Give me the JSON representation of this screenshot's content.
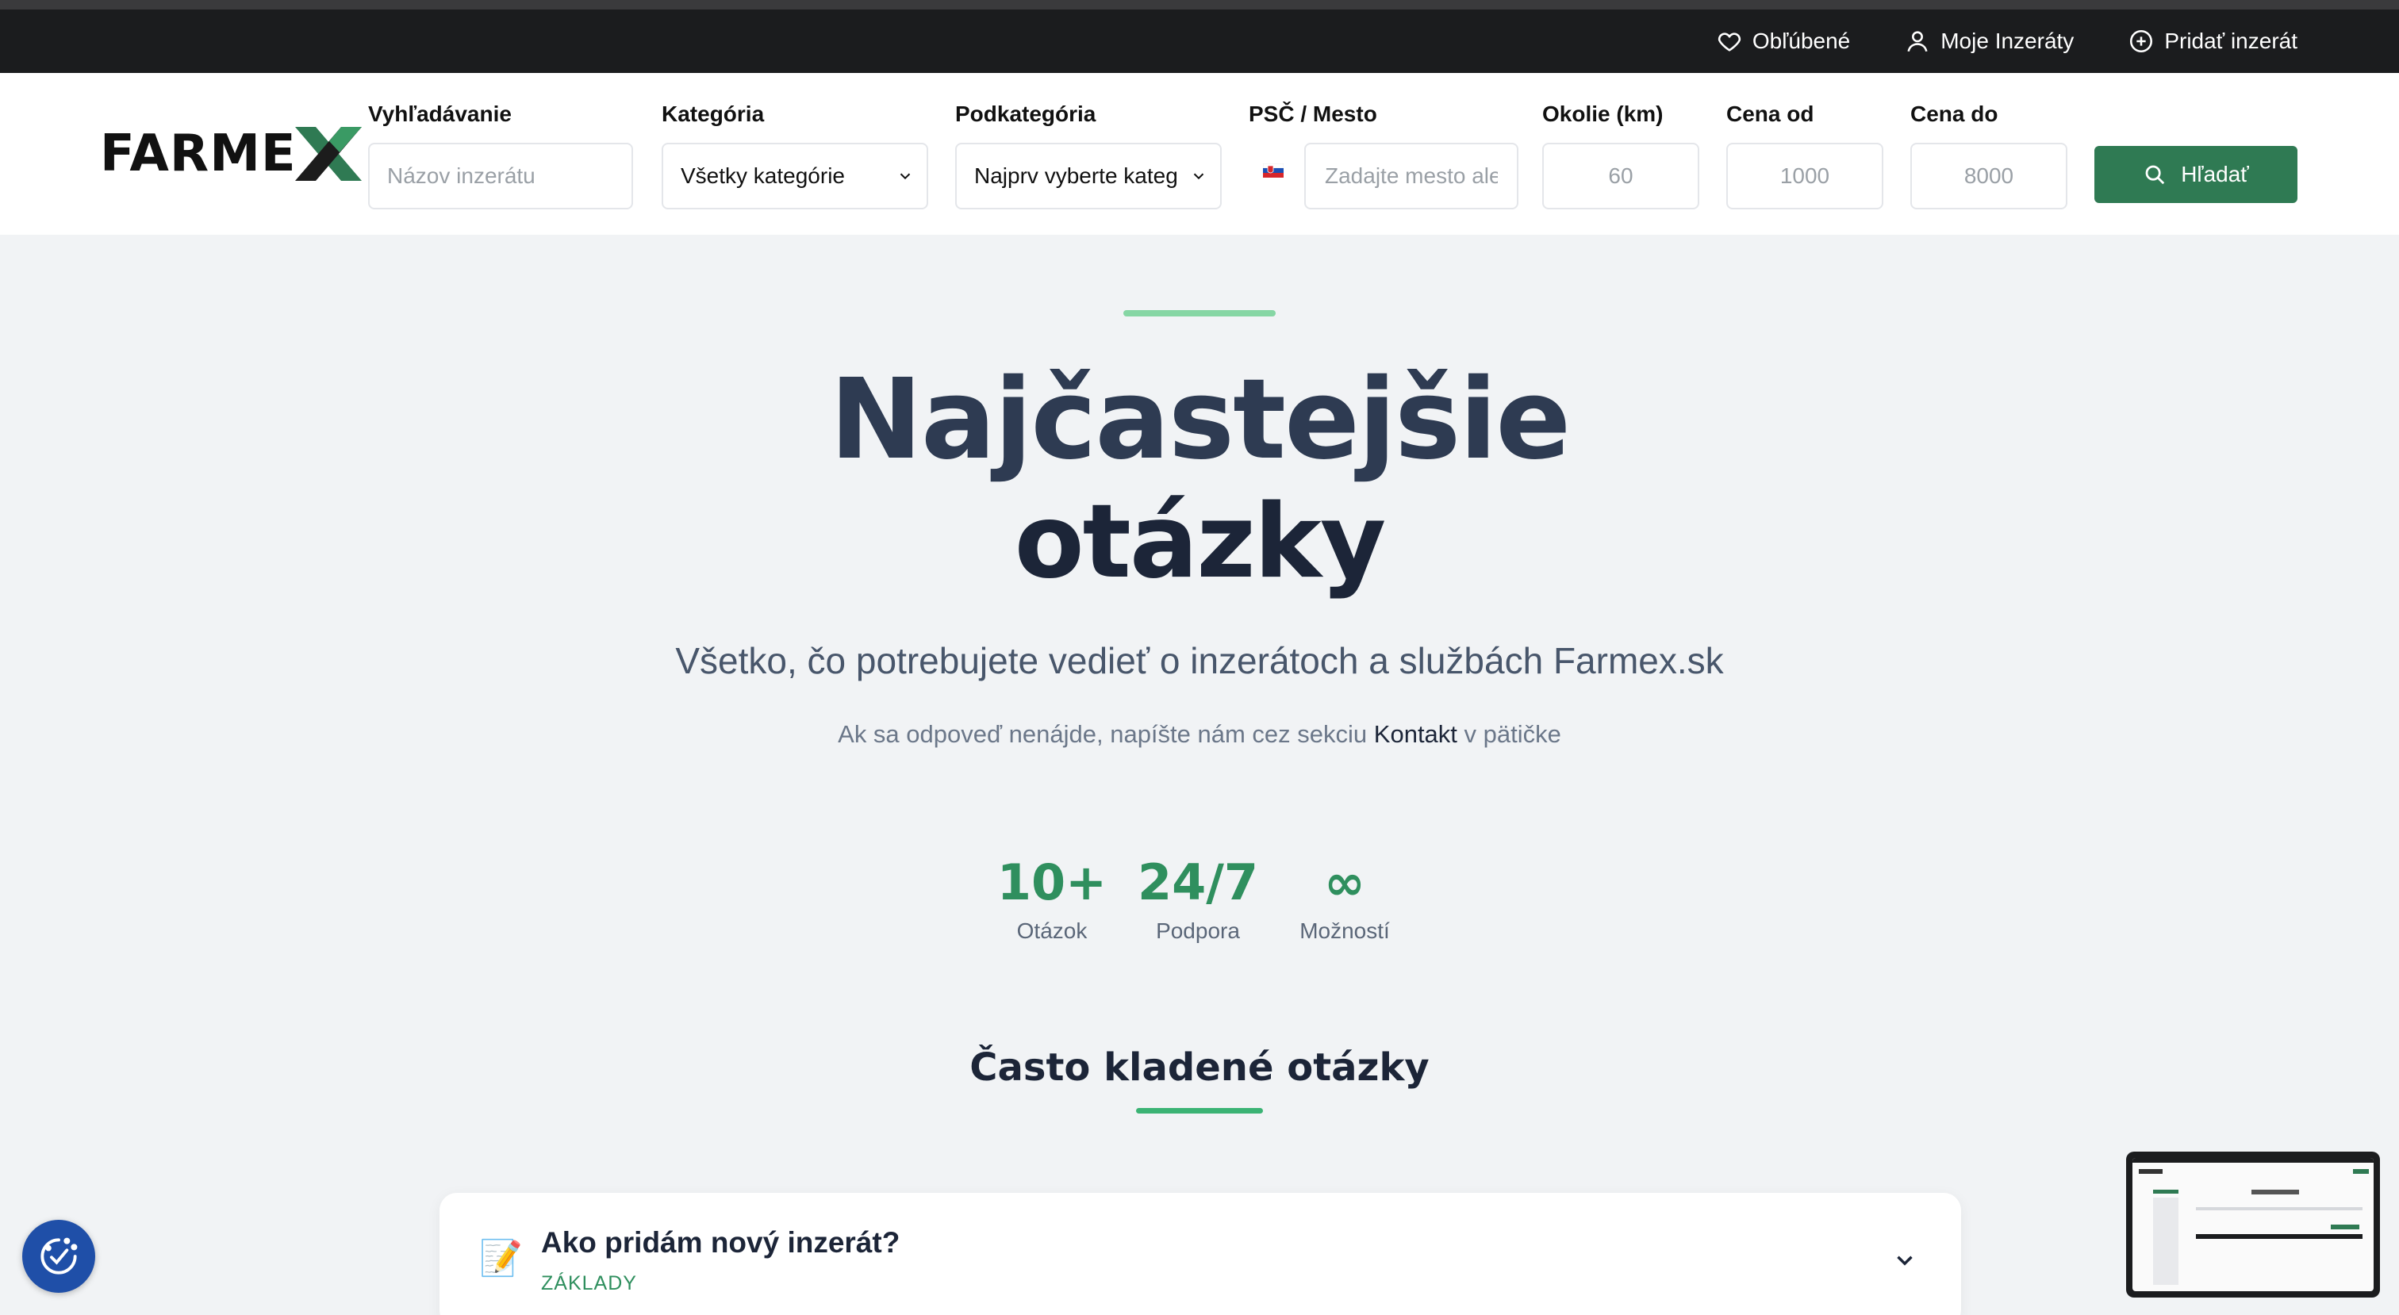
{
  "topbar": {
    "favorites": "Obľúbené",
    "my_ads": "Moje Inzeráty",
    "add_ad": "Pridať inzerát"
  },
  "header": {
    "logo": {
      "main": "FARME",
      "x": "X"
    },
    "search": {
      "label": "Vyhľadávanie",
      "placeholder": "Názov inzerátu"
    },
    "category": {
      "label": "Kategória",
      "selected": "Všetky kategórie"
    },
    "subcategory": {
      "label": "Podkategória",
      "selected": "Najprv vyberte kateg"
    },
    "location": {
      "label": "PSČ / Mesto",
      "placeholder": "Zadajte mesto ale"
    },
    "radius": {
      "label": "Okolie (km)",
      "placeholder": "60"
    },
    "price_from": {
      "label": "Cena od",
      "placeholder": "1000"
    },
    "price_to": {
      "label": "Cena do",
      "placeholder": "8000"
    },
    "search_button": "Hľadať"
  },
  "hero": {
    "title_line1": "Najčastejšie",
    "title_line2": "otázky",
    "subtitle": "Všetko, čo potrebujete vedieť o inzerátoch a službách Farmex.sk",
    "note_before": "Ak sa odpoveď nenájde, napíšte nám cez sekciu ",
    "note_link": "Kontakt",
    "note_after": " v pätičke"
  },
  "stats": [
    {
      "value": "10+",
      "label": "Otázok"
    },
    {
      "value": "24/7",
      "label": "Podpora"
    },
    {
      "value": "∞",
      "label": "Možností"
    }
  ],
  "faq": {
    "heading": "Často kladené otázky",
    "items": [
      {
        "icon": "📝",
        "question": "Ako pridám nový inzerát?",
        "category": "ZÁKLADY"
      }
    ]
  },
  "colors": {
    "brand_green": "#2f7a53",
    "accent_green": "#3bb374",
    "topbar": "#1b1c1e",
    "cookie_blue": "#1f4fa8"
  }
}
